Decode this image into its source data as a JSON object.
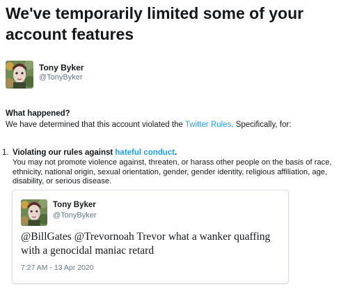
{
  "page": {
    "title": "We've temporarily limited some of your account features"
  },
  "account": {
    "name": "Tony Byker",
    "handle": "@TonyByker",
    "avatar_icon": "user-avatar-portrait-icon"
  },
  "what_happened": {
    "heading": "What happened?",
    "text_before": "We have determined that this account violated the ",
    "link_text": "Twitter Rules",
    "text_after": ". Specifically, for:"
  },
  "violations": [
    {
      "number": "1.",
      "title_before": "Violating our rules against ",
      "title_link": "hateful conduct",
      "title_after": ".",
      "description": "You may not promote violence against, threaten, or harass other people on the basis of race, ethnicity, national origin, sexual orientation, gender, gender identity, religious affiliation, age, disability, or serious disease."
    }
  ],
  "tweet": {
    "author_name": "Tony Byker",
    "author_handle": "@TonyByker",
    "text": "@BillGates @Trevornoah Trevor what a wanker quaffing with a genocidal maniac retard",
    "timestamp": "7:27 AM - 13 Apr 2020"
  },
  "colors": {
    "link": "#1da1f2",
    "secondary_text": "#657786",
    "primary_text": "#14171a",
    "card_border": "#d8dee3"
  }
}
